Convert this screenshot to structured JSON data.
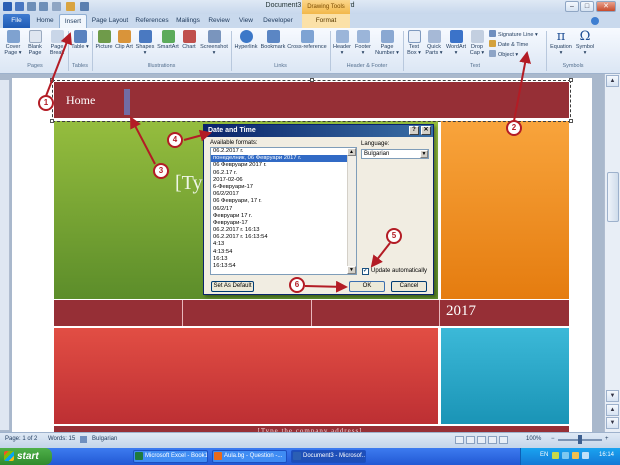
{
  "window": {
    "title": "Document3 - Microsoft Word",
    "contextual_tab": "Drawing Tools"
  },
  "tabs": [
    {
      "label": "File"
    },
    {
      "label": "Home"
    },
    {
      "label": "Insert"
    },
    {
      "label": "Page Layout"
    },
    {
      "label": "References"
    },
    {
      "label": "Mailings"
    },
    {
      "label": "Review"
    },
    {
      "label": "View"
    },
    {
      "label": "Developer"
    },
    {
      "label": "Format"
    }
  ],
  "ribbon": {
    "pages": {
      "cover_page": "Cover Page ▾",
      "blank_page": "Blank Page",
      "page_break": "Page Break",
      "label": "Pages"
    },
    "tables": {
      "table": "Table ▾",
      "label": "Tables"
    },
    "illustrations": {
      "picture": "Picture",
      "clip_art": "Clip Art",
      "shapes": "Shapes ▾",
      "smartart": "SmartArt",
      "chart": "Chart",
      "screenshot": "Screenshot ▾",
      "label": "Illustrations"
    },
    "links": {
      "hyperlink": "Hyperlink",
      "bookmark": "Bookmark",
      "cross_reference": "Cross-reference",
      "label": "Links"
    },
    "header_footer": {
      "header": "Header ▾",
      "footer": "Footer ▾",
      "page_number": "Page Number ▾",
      "label": "Header & Footer"
    },
    "text": {
      "text_box": "Text Box ▾",
      "quick_parts": "Quick Parts ▾",
      "wordart": "WordArt ▾",
      "drop_cap": "Drop Cap ▾",
      "signature_line": "Signature Line ▾",
      "date_time": "Date & Time",
      "object": "Object ▾",
      "label": "Text"
    },
    "symbols": {
      "equation": "Equation ▾",
      "symbol": "Symbol ▾",
      "label": "Symbols"
    }
  },
  "document": {
    "home_text": "Home",
    "placeholder": "[Ty",
    "year": "2017",
    "address": "[Type the company address]"
  },
  "dialog": {
    "title": "Date and Time",
    "help": "?",
    "close": "✕",
    "formats_label": "Available formats:",
    "language_label": "Language:",
    "language_value": "Bulgarian",
    "formats": [
      "06.2.2017 г.",
      "понеделник, 06 Февруари 2017 г.",
      "06 Февруари 2017 г.",
      "06.2.17 г.",
      "2017-02-06",
      "6-Февруари-17",
      "06/2/2017",
      "06 Февруари, 17 г.",
      "06/2/17",
      "Февруари 17 г.",
      "Февруари-17",
      "06.2.2017 г. 16:13",
      "06.2.2017 г. 16:13:54",
      "4:13",
      "4:13:54",
      "16:13",
      "16:13:54"
    ],
    "selected_index": 1,
    "update_label": "Update automatically",
    "update_checked": "✓",
    "set_default": "Set As Default",
    "ok": "OK",
    "cancel": "Cancel"
  },
  "status": {
    "page": "Page: 1 of 2",
    "words": "Words: 15",
    "language": "Bulgarian",
    "zoom": "100%"
  },
  "taskbar": {
    "start": "start",
    "items": [
      {
        "label": "Microsoft Excel - Book1",
        "color": "#1f7a3d"
      },
      {
        "label": "Aula.bg - Question -...",
        "color": "#e86a1c"
      },
      {
        "label": "Document3 - Microsof...",
        "color": "#2b5fb4"
      }
    ],
    "tray_lang": "EN",
    "clock": "16:14"
  },
  "annotations": {
    "b1": "1",
    "b2": "2",
    "b3": "3",
    "b4": "4",
    "b5": "5",
    "b6": "6"
  },
  "colors": {
    "accent_red": "#b31c25",
    "block_red": "#962f36",
    "block_green": "#7aa636",
    "block_orange": "#f08c24",
    "block_cyan": "#27a7c8"
  }
}
